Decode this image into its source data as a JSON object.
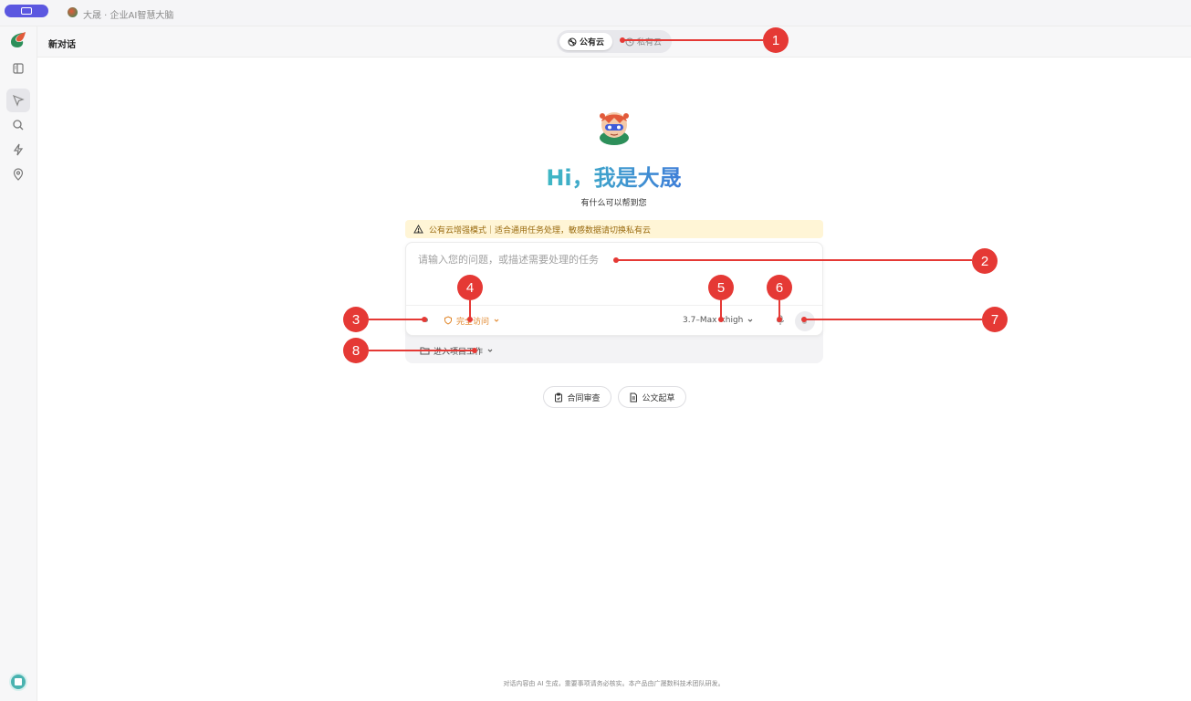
{
  "titlebar": {
    "title": "大晟 · 企业AI智慧大脑"
  },
  "header": {
    "title": "新对话",
    "toggle": {
      "public_label": "公有云",
      "private_label": "私有云"
    }
  },
  "sidebar": {
    "items": [
      {
        "icon": "panel-icon"
      },
      {
        "icon": "cursor-icon",
        "active": true
      },
      {
        "icon": "search-icon"
      },
      {
        "icon": "lightning-icon"
      },
      {
        "icon": "location-icon"
      }
    ]
  },
  "hero": {
    "greeting": "Hi，我是大晟",
    "subtitle": "有什么可以帮到您"
  },
  "warning": {
    "text": "公有云增强模式｜适合通用任务处理，敏感数据请切换私有云"
  },
  "composer": {
    "placeholder": "请输入您的问题，或描述需要处理的任务",
    "access_label": "完全访问",
    "model_label": "3.7–Max",
    "effort_label": "xhigh",
    "project_label": "进入项目工作"
  },
  "quick_actions": [
    {
      "label": "合同审查",
      "icon": "clipboard-check-icon"
    },
    {
      "label": "公文起草",
      "icon": "document-icon"
    }
  ],
  "footer": {
    "text": "对话内容由 AI 生成，重要事项请务必核实。本产品由广晟数科技术团队研发。"
  },
  "callouts": [
    "1",
    "2",
    "3",
    "4",
    "5",
    "6",
    "7",
    "8"
  ],
  "colors": {
    "accent": "#5b57e0",
    "callout": "#e53935",
    "warning_bg": "#fff5d6",
    "greeting_start": "#3fb8c4",
    "greeting_end": "#3f7ed8"
  }
}
